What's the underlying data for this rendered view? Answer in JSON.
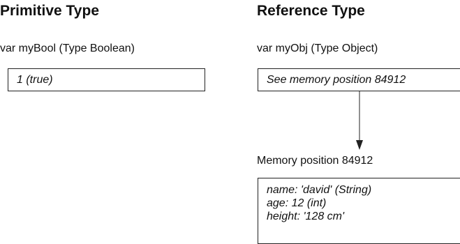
{
  "primitive": {
    "heading": "Primitive Type",
    "declaration": "var myBool (Type Boolean)",
    "value": "1 (true)"
  },
  "reference": {
    "heading": "Reference Type",
    "declaration": "var myObj (Type Object)",
    "value": "See memory position 84912",
    "memory_label": "Memory position 84912",
    "memory_lines": [
      "name: 'david' (String)",
      "age: 12 (int)",
      "height: '128 cm'"
    ]
  }
}
